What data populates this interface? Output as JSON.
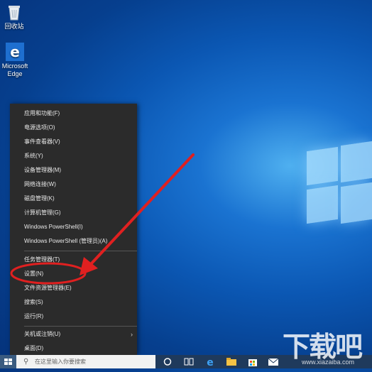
{
  "desktop": {
    "icons": [
      {
        "label": "回收站",
        "icon": "recycle-bin-icon"
      },
      {
        "label": "Microsoft Edge",
        "icon": "edge-icon"
      }
    ]
  },
  "menu": {
    "items": [
      {
        "label": "应用和功能(F)"
      },
      {
        "label": "电源选项(O)"
      },
      {
        "label": "事件查看器(V)"
      },
      {
        "label": "系统(Y)"
      },
      {
        "label": "设备管理器(M)"
      },
      {
        "label": "网络连接(W)"
      },
      {
        "label": "磁盘管理(K)"
      },
      {
        "label": "计算机管理(G)"
      },
      {
        "label": "Windows PowerShell(I)"
      },
      {
        "label": "Windows PowerShell (管理员)(A)"
      },
      {
        "label": "任务管理器(T)"
      },
      {
        "label": "设置(N)"
      },
      {
        "label": "文件资源管理器(E)"
      },
      {
        "label": "搜索(S)"
      },
      {
        "label": "运行(R)"
      },
      {
        "label": "关机或注销(U)"
      },
      {
        "label": "桌面(D)"
      }
    ]
  },
  "taskbar": {
    "search_placeholder": "在这里输入你要搜索",
    "icons": [
      "cortana-icon",
      "task-view-icon",
      "edge-icon",
      "file-explorer-icon",
      "store-icon",
      "mail-icon"
    ]
  },
  "annotation": {
    "highlight_color": "#e02020"
  },
  "watermark": {
    "text": "下载吧",
    "url": "www.xiazaiba.com"
  }
}
